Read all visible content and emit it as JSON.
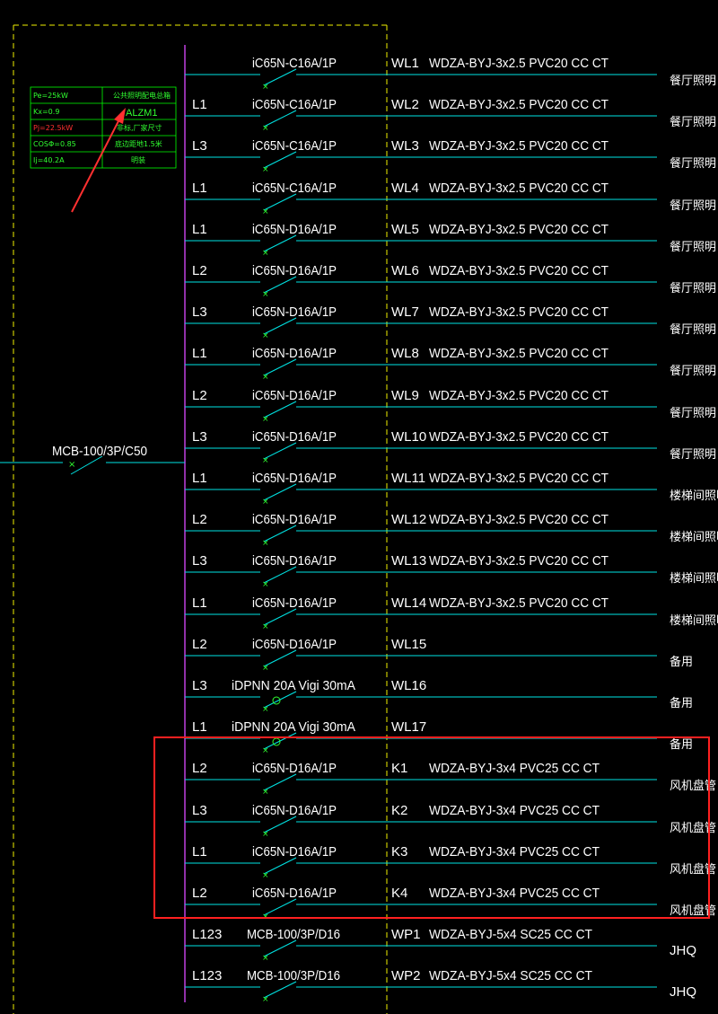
{
  "colors": {
    "background": "#000000",
    "circuit_line": "#00e5e5",
    "bus_bar": "#c040e0",
    "dashed_frame": "#f0f000",
    "breaker_green": "#30ff30",
    "text": "#ffffff",
    "info_table_border": "#00ff00",
    "info_red": "#ff3030",
    "highlight_box": "#ff2020",
    "arrow": "#ff3030"
  },
  "main_breaker": {
    "label": "MCB-100/3P/C50"
  },
  "info_table": {
    "rows": [
      {
        "left": "Pe=25kW",
        "right": "公共照明配电总箱"
      },
      {
        "left": "Kx=0.9",
        "right": "ALZM1"
      },
      {
        "left": "Pj=22.5kW",
        "right": "非标,厂家尺寸"
      },
      {
        "left": "COSΦ=0.85",
        "right": "底边距地1.5米"
      },
      {
        "left": "Ij=40.2A",
        "right": "明装"
      }
    ]
  },
  "circuits": [
    {
      "phase": "",
      "breaker": "iC65N-C16A/1P",
      "circuit_id": "WL1",
      "cable": "WDZA-BYJ-3x2.5 PVC20 CC CT",
      "load": "餐厅照明",
      "type": "switch"
    },
    {
      "phase": "L1",
      "breaker": "iC65N-C16A/1P",
      "circuit_id": "WL2",
      "cable": "WDZA-BYJ-3x2.5 PVC20 CC CT",
      "load": "餐厅照明",
      "type": "switch"
    },
    {
      "phase": "L3",
      "breaker": "iC65N-C16A/1P",
      "circuit_id": "WL3",
      "cable": "WDZA-BYJ-3x2.5 PVC20 CC CT",
      "load": "餐厅照明",
      "type": "switch"
    },
    {
      "phase": "L1",
      "breaker": "iC65N-C16A/1P",
      "circuit_id": "WL4",
      "cable": "WDZA-BYJ-3x2.5 PVC20 CC CT",
      "load": "餐厅照明",
      "type": "switch"
    },
    {
      "phase": "L1",
      "breaker": "iC65N-D16A/1P",
      "circuit_id": "WL5",
      "cable": "WDZA-BYJ-3x2.5 PVC20 CC CT",
      "load": "餐厅照明",
      "type": "switch"
    },
    {
      "phase": "L2",
      "breaker": "iC65N-D16A/1P",
      "circuit_id": "WL6",
      "cable": "WDZA-BYJ-3x2.5 PVC20 CC CT",
      "load": "餐厅照明",
      "type": "switch"
    },
    {
      "phase": "L3",
      "breaker": "iC65N-D16A/1P",
      "circuit_id": "WL7",
      "cable": "WDZA-BYJ-3x2.5 PVC20 CC CT",
      "load": "餐厅照明",
      "type": "switch"
    },
    {
      "phase": "L1",
      "breaker": "iC65N-D16A/1P",
      "circuit_id": "WL8",
      "cable": "WDZA-BYJ-3x2.5 PVC20 CC CT",
      "load": "餐厅照明",
      "type": "switch"
    },
    {
      "phase": "L2",
      "breaker": "iC65N-D16A/1P",
      "circuit_id": "WL9",
      "cable": "WDZA-BYJ-3x2.5 PVC20 CC CT",
      "load": "餐厅照明",
      "type": "switch"
    },
    {
      "phase": "L3",
      "breaker": "iC65N-D16A/1P",
      "circuit_id": "WL10",
      "cable": "WDZA-BYJ-3x2.5 PVC20 CC CT",
      "load": "餐厅照明",
      "type": "switch"
    },
    {
      "phase": "L1",
      "breaker": "iC65N-D16A/1P",
      "circuit_id": "WL11",
      "cable": "WDZA-BYJ-3x2.5 PVC20 CC CT",
      "load": "楼梯间照明",
      "type": "switch"
    },
    {
      "phase": "L2",
      "breaker": "iC65N-D16A/1P",
      "circuit_id": "WL12",
      "cable": "WDZA-BYJ-3x2.5 PVC20 CC CT",
      "load": "楼梯间照明",
      "type": "switch"
    },
    {
      "phase": "L3",
      "breaker": "iC65N-D16A/1P",
      "circuit_id": "WL13",
      "cable": "WDZA-BYJ-3x2.5 PVC20 CC CT",
      "load": "楼梯间照明",
      "type": "switch"
    },
    {
      "phase": "L1",
      "breaker": "iC65N-D16A/1P",
      "circuit_id": "WL14",
      "cable": "WDZA-BYJ-3x2.5 PVC20 CC CT",
      "load": "楼梯间照明",
      "type": "switch"
    },
    {
      "phase": "L2",
      "breaker": "iC65N-D16A/1P",
      "circuit_id": "WL15",
      "cable": "",
      "load": "备用",
      "type": "switch"
    },
    {
      "phase": "L3",
      "breaker": "iDPNN 20A Vigi 30mA",
      "circuit_id": "WL16",
      "cable": "",
      "load": "备用",
      "type": "rcd"
    },
    {
      "phase": "L1",
      "breaker": "iDPNN 20A Vigi 30mA",
      "circuit_id": "WL17",
      "cable": "",
      "load": "备用",
      "type": "rcd"
    },
    {
      "phase": "L2",
      "breaker": "iC65N-D16A/1P",
      "circuit_id": "K1",
      "cable": "WDZA-BYJ-3x4 PVC25 CC CT",
      "load": "风机盘管",
      "type": "switch"
    },
    {
      "phase": "L3",
      "breaker": "iC65N-D16A/1P",
      "circuit_id": "K2",
      "cable": "WDZA-BYJ-3x4 PVC25 CC CT",
      "load": "风机盘管",
      "type": "switch"
    },
    {
      "phase": "L1",
      "breaker": "iC65N-D16A/1P",
      "circuit_id": "K3",
      "cable": "WDZA-BYJ-3x4 PVC25 CC CT",
      "load": "风机盘管",
      "type": "switch"
    },
    {
      "phase": "L2",
      "breaker": "iC65N-D16A/1P",
      "circuit_id": "K4",
      "cable": "WDZA-BYJ-3x4 PVC25 CC CT",
      "load": "风机盘管",
      "type": "switch"
    },
    {
      "phase": "L123",
      "breaker": "MCB-100/3P/D16",
      "circuit_id": "WP1",
      "cable": "WDZA-BYJ-5x4 SC25 CC CT",
      "load": "JHQ",
      "type": "switch"
    },
    {
      "phase": "L123",
      "breaker": "MCB-100/3P/D16",
      "circuit_id": "WP2",
      "cable": "WDZA-BYJ-5x4 SC25 CC CT",
      "load": "JHQ",
      "type": "switch"
    }
  ]
}
